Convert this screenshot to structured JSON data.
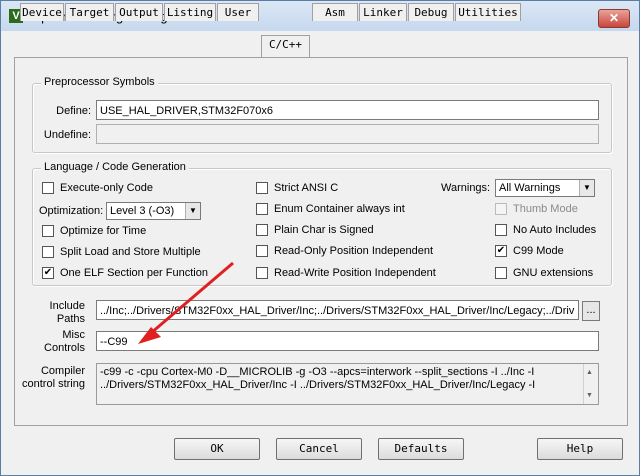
{
  "window": {
    "title": "Options for Target 'Program'",
    "icon_letter": "V",
    "close_glyph": "✕"
  },
  "tabs": [
    "Device",
    "Target",
    "Output",
    "Listing",
    "User",
    "C/C++",
    "Asm",
    "Linker",
    "Debug",
    "Utilities"
  ],
  "active_tab": "C/C++",
  "preprocessor": {
    "title": "Preprocessor Symbols",
    "define_label": "Define:",
    "define_value": "USE_HAL_DRIVER,STM32F070x6",
    "undefine_label": "Undefine:",
    "undefine_value": ""
  },
  "language": {
    "title": "Language / Code Generation",
    "execute_only": {
      "label": "Execute-only Code",
      "checked": false
    },
    "optimization_label": "Optimization:",
    "optimization_value": "Level 3 (-O3)",
    "optimize_time": {
      "label": "Optimize for Time",
      "checked": false
    },
    "split_load": {
      "label": "Split Load and Store Multiple",
      "checked": false
    },
    "one_elf": {
      "label": "One ELF Section per Function",
      "checked": true
    },
    "strict_ansi": {
      "label": "Strict ANSI C",
      "checked": false
    },
    "enum_container": {
      "label": "Enum Container always int",
      "checked": false
    },
    "plain_char": {
      "label": "Plain Char is Signed",
      "checked": false
    },
    "ro_pi": {
      "label": "Read-Only Position Independent",
      "checked": false
    },
    "rw_pi": {
      "label": "Read-Write Position Independent",
      "checked": false
    },
    "warnings_label": "Warnings:",
    "warnings_value": "All Warnings",
    "thumb_mode": {
      "label": "Thumb Mode",
      "checked": false,
      "disabled": true
    },
    "no_auto_includes": {
      "label": "No Auto Includes",
      "checked": false
    },
    "c99_mode": {
      "label": "C99 Mode",
      "checked": true
    },
    "gnu_extensions": {
      "label": "GNU extensions",
      "checked": false
    }
  },
  "include_paths": {
    "label": "Include Paths",
    "value": "../Inc;../Drivers/STM32F0xx_HAL_Driver/Inc;../Drivers/STM32F0xx_HAL_Driver/Inc/Legacy;../Driv",
    "browse_label": "..."
  },
  "misc_controls": {
    "label": "Misc Controls",
    "value": "--C99"
  },
  "compiler_control": {
    "label": "Compiler control string",
    "line1": "-c99 -c -cpu Cortex-M0 -D__MICROLIB -g -O3 --apcs=interwork --split_sections -I ../Inc -I",
    "line2": "../Drivers/STM32F0xx_HAL_Driver/Inc -I ../Drivers/STM32F0xx_HAL_Driver/Inc/Legacy -I"
  },
  "buttons": {
    "ok": "OK",
    "cancel": "Cancel",
    "defaults": "Defaults",
    "help": "Help"
  },
  "check_glyph": "✔",
  "colors": {
    "annotation_arrow": "#e02020"
  }
}
